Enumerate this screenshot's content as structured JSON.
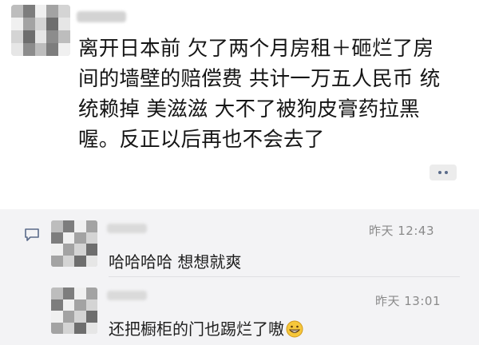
{
  "post": {
    "author_avatar": "blurred-avatar",
    "text_lines": [
      "离开日本前 欠了两个月房租＋砸烂了房",
      "间的墙壁的赔偿费 共计一万五人民币 统",
      "统赖掉 美滋滋 大不了被狗皮膏药拉黑",
      "喔。反正以后再也不会去了"
    ],
    "more_icon": "ellipsis-icon"
  },
  "comments": {
    "section_icon": "comment-bubble-icon",
    "items": [
      {
        "avatar": "blurred-avatar",
        "time": "昨天 12:43",
        "text": "哈哈哈哈 想想就爽"
      },
      {
        "avatar": "blurred-avatar",
        "time": "昨天 13:01",
        "text": "还把橱柜的门也踢烂了嗷",
        "emoji": "grinning-face-icon"
      }
    ]
  },
  "colors": {
    "comment_bg": "#f3f3f5",
    "time_gray": "#8a8a8a",
    "link_blue": "#5a6b8a"
  }
}
